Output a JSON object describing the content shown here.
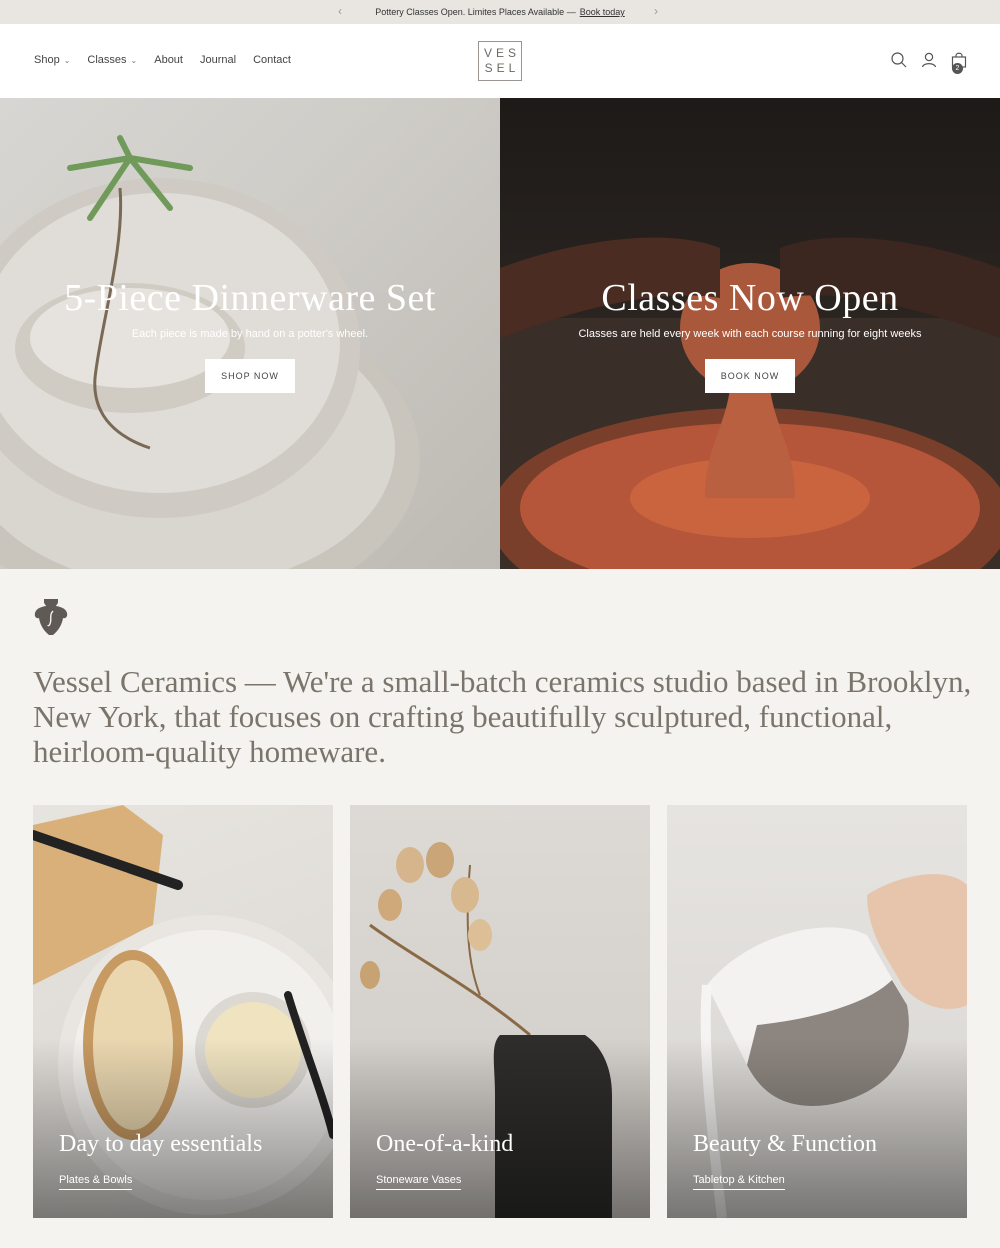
{
  "announcement": {
    "text": "Pottery Classes Open. Limites Places Available —",
    "link": "Book today",
    "prev_icon": "chevron-left-icon",
    "next_icon": "chevron-right-icon"
  },
  "header": {
    "nav": [
      {
        "label": "Shop",
        "has_dropdown": true
      },
      {
        "label": "Classes",
        "has_dropdown": true
      },
      {
        "label": "About",
        "has_dropdown": false
      },
      {
        "label": "Journal",
        "has_dropdown": false
      },
      {
        "label": "Contact",
        "has_dropdown": false
      }
    ],
    "logo": {
      "line1": "VES",
      "line2": "SEL"
    },
    "icons": [
      "search-icon",
      "account-icon",
      "cart-icon"
    ],
    "cart_count": "2"
  },
  "hero": [
    {
      "title": "5-Piece Dinnerware Set",
      "subtitle": "Each piece is made by hand on a potter's wheel.",
      "button": "SHOP NOW"
    },
    {
      "title": "Classes Now Open",
      "subtitle": "Classes are held every week with each course running for eight weeks",
      "button": "BOOK NOW"
    }
  ],
  "intro": {
    "text": "Vessel Ceramics — We're a small-batch ceramics studio based in Brooklyn, New York, that focuses on crafting beautifully sculptured, functional, heirloom-quality homeware."
  },
  "collections": [
    {
      "title": "Day to day essentials",
      "link": "Plates & Bowls"
    },
    {
      "title": "One-of-a-kind",
      "link": "Stoneware Vases"
    },
    {
      "title": "Beauty & Function",
      "link": "Tabletop & Kitchen"
    }
  ],
  "colors": {
    "announcement_bg": "#e9e6e1",
    "page_bg": "#f4f3f0",
    "intro_text": "#7a746b",
    "logo_border": "#9a9590"
  }
}
